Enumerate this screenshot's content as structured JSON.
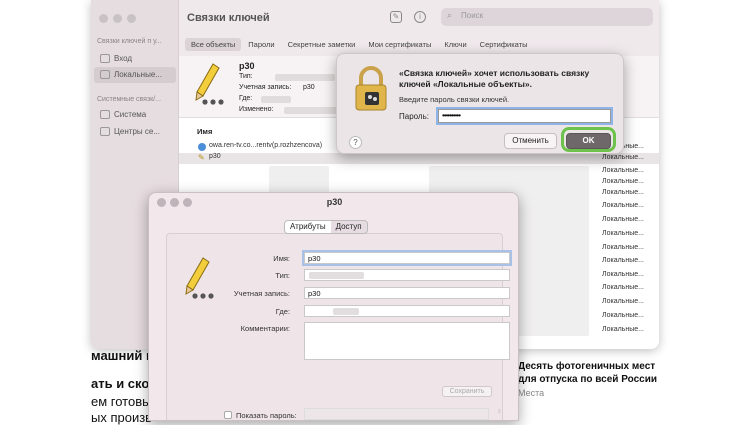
{
  "keychain": {
    "title": "Связки ключей",
    "search_placeholder": "Поиск",
    "sidebar": {
      "heading_user": "Связки ключей п у...",
      "items_user": [
        "Вход",
        "Локальные..."
      ],
      "heading_system": "Системные связк/...",
      "items_system": [
        "Система",
        "Центры се..."
      ]
    },
    "tabs": [
      "Все объекты",
      "Пароли",
      "Секретные заметки",
      "Мои сертификаты",
      "Ключи",
      "Сертификаты"
    ],
    "selected_item": {
      "name": "p30",
      "type_label": "Тип:",
      "account_label": "Учетная запись:",
      "account_value": "p30",
      "where_label": "Где:",
      "modified_label": "Изменено:"
    },
    "column_name": "Имя",
    "rows": [
      {
        "name": "owa.ren-tv.co...rentv(p.rozhzencova)",
        "kind": "Локальные..."
      },
      {
        "name": "p30",
        "kind": "Локальные..."
      },
      {
        "name": "",
        "kind": "Локальные..."
      },
      {
        "name": "",
        "kind": "Локальные..."
      },
      {
        "name": "",
        "kind": "Локальные..."
      },
      {
        "name": "",
        "kind": "Локальные..."
      },
      {
        "name": "",
        "kind": "Локальные..."
      },
      {
        "name": "",
        "kind": "Локальные..."
      },
      {
        "name": "",
        "kind": "Локальные..."
      },
      {
        "name": "",
        "kind": "Локальные..."
      },
      {
        "name": "",
        "kind": "Локальные..."
      },
      {
        "name": "",
        "kind": "Локальные..."
      },
      {
        "name": "",
        "kind": "Локальные..."
      },
      {
        "name": "",
        "kind": "Локальные..."
      },
      {
        "name": "",
        "kind": "Локальные..."
      }
    ]
  },
  "auth_dialog": {
    "title": "«Связка ключей» хочет использовать связку ключей «Локальные объекты».",
    "subtitle": "Введите пароль связки ключей.",
    "password_label": "Пароль:",
    "password_value": "••••••••••",
    "help": "?",
    "cancel_label": "Отменить",
    "ok_label": "OK"
  },
  "detail": {
    "title": "p30",
    "tabs": [
      "Атрибуты",
      "Доступ"
    ],
    "name_label": "Имя:",
    "name_value": "p30",
    "kind_label": "Тип:",
    "account_label": "Учетная запись:",
    "account_value": "p30",
    "where_label": "Где:",
    "comments_label": "Комментарии:",
    "show_password_label": "Показать пароль:",
    "save_label": "Сохранить"
  },
  "article": {
    "left_lines": [
      "машний к",
      "ать и скол",
      "ем готовы",
      "ых произв"
    ],
    "right_title_1": "Десять фотогеничных мест",
    "right_title_2": "для отпуска по всей России",
    "right_meta": "Места"
  }
}
